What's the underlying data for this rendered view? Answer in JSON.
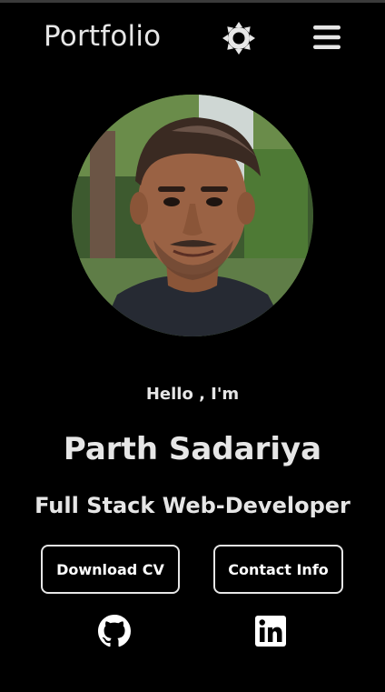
{
  "header": {
    "brand": "Portfolio",
    "theme_icon": "sun-icon",
    "menu_icon": "hamburger-menu-icon"
  },
  "hero": {
    "greeting": "Hello , I'm",
    "name": "Parth Sadariya",
    "role": "Full Stack Web-Developer",
    "avatar_alt": "profile-photo"
  },
  "actions": {
    "download_cv": "Download CV",
    "contact_info": "Contact Info"
  },
  "social": {
    "github_icon": "github-icon",
    "linkedin_icon": "linkedin-icon"
  },
  "colors": {
    "background": "#000000",
    "text": "#e6e6e6",
    "button_border": "#e6e6e6"
  }
}
